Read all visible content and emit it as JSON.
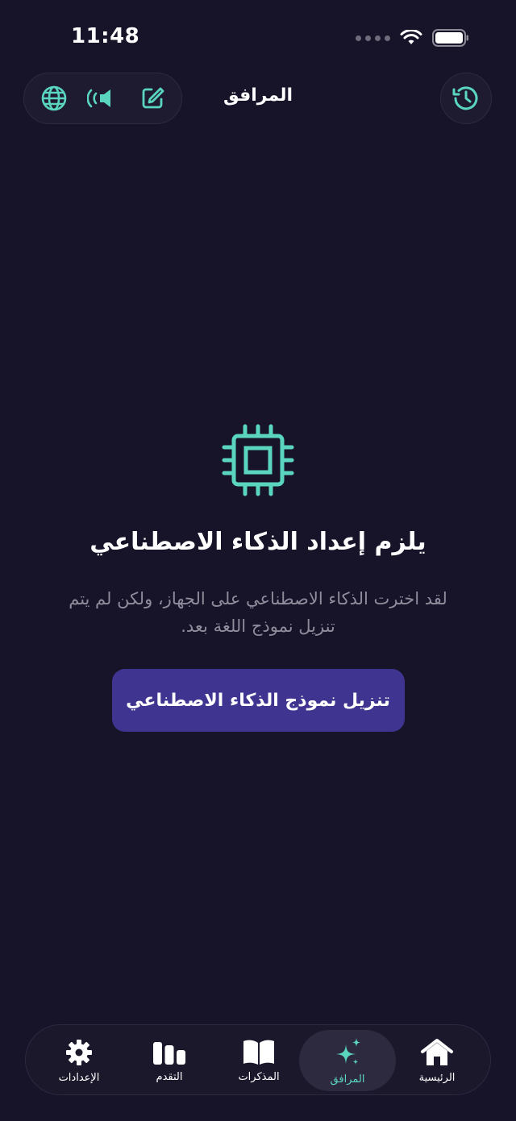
{
  "status": {
    "time": "11:48"
  },
  "header": {
    "title": "المرافق",
    "icons": [
      "globe-icon",
      "speaker-icon",
      "edit-icon",
      "history-icon"
    ]
  },
  "empty_state": {
    "icon": "chip-icon",
    "title": "يلزم إعداد الذكاء الاصطناعي",
    "description": "لقد اخترت الذكاء الاصطناعي على الجهاز، ولكن لم يتم تنزيل نموذج اللغة بعد.",
    "button_label": "تنزيل نموذج الذكاء الاصطناعي"
  },
  "tabs": [
    {
      "label": "الإعدادات",
      "icon": "gear-icon"
    },
    {
      "label": "التقدم",
      "icon": "bar-chart-icon"
    },
    {
      "label": "المذكرات",
      "icon": "book-icon"
    },
    {
      "label": "المرافق",
      "icon": "sparkles-icon",
      "active": true
    },
    {
      "label": "الرئيسية",
      "icon": "home-icon"
    }
  ],
  "colors": {
    "background": "#17142a",
    "accent": "#5ad6bf",
    "button": "#3f3590"
  }
}
